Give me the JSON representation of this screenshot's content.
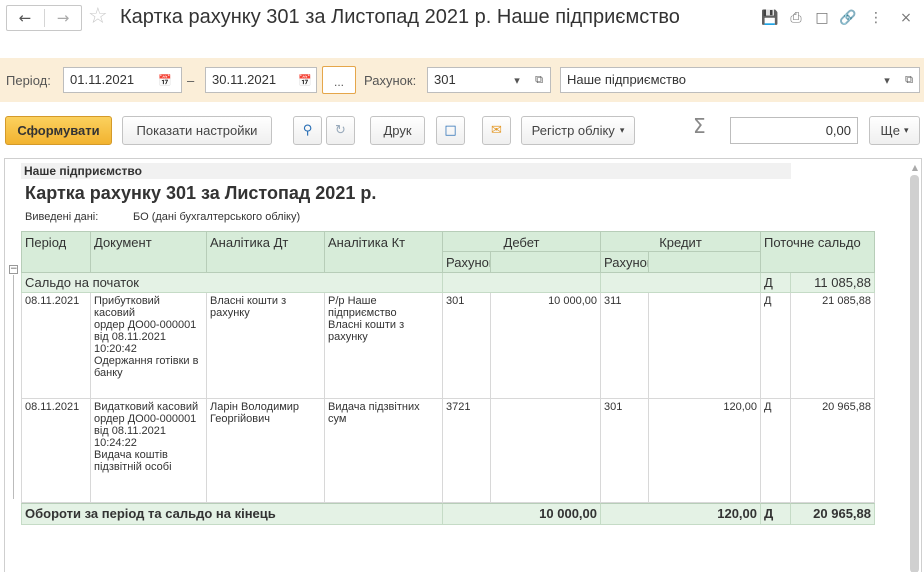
{
  "window": {
    "title": "Картка рахунку 301 за Листопад 2021 р. Наше підприємство",
    "icons": [
      "save-icon",
      "print-icon",
      "preview-icon",
      "link-icon",
      "more-icon",
      "close-icon"
    ]
  },
  "params": {
    "period_label": "Період:",
    "date_from": "01.11.2021",
    "dash": "–",
    "date_to": "30.11.2021",
    "dots": "...",
    "account_label": "Рахунок:",
    "account": "301",
    "organization": "Наше підприємство"
  },
  "toolbar": {
    "generate": "Сформувати",
    "show_settings": "Показати настройки",
    "print": "Друк",
    "register": "Регістр обліку",
    "sigma": "Σ",
    "sum": "0,00",
    "more": "Ще"
  },
  "report": {
    "organization": "Наше підприємство",
    "title": "Картка рахунку 301 за Листопад 2021 р.",
    "output_label": "Виведені дані:",
    "output_value": "БО (дані бухгалтерського обліку)",
    "headers": {
      "period": "Період",
      "document": "Документ",
      "analytics_dt": "Аналітика Дт",
      "analytics_kt": "Аналітика Кт",
      "debit": "Дебет",
      "credit": "Кредит",
      "balance": "Поточне сальдо",
      "account_dt": "Рахунок",
      "account_kt": "Рахунок"
    },
    "opening": {
      "label": "Сальдо на початок",
      "side": "Д",
      "amount": "11 085,88"
    },
    "rows": [
      {
        "period": "08.11.2021",
        "document": [
          "Прибутковий касовий",
          "ордер ДО00-000001",
          "від 08.11.2021",
          "10:20:42",
          "Одержання готівки в",
          "банку"
        ],
        "analytics_dt": [
          "Власні кошти з",
          "рахунку"
        ],
        "analytics_kt": [
          "Р/р Наше",
          "підприємство",
          "Власні кошти з",
          "рахунку"
        ],
        "dt_account": "301",
        "dt_amount": "10 000,00",
        "kt_account": "311",
        "kt_amount": "",
        "side": "Д",
        "balance": "21 085,88"
      },
      {
        "period": "08.11.2021",
        "document": [
          "Видатковий касовий",
          "ордер ДО00-000001",
          "від 08.11.2021",
          "10:24:22",
          "Видача коштів",
          "підзвітній особі"
        ],
        "analytics_dt": [
          "Ларін Володимир",
          "Георгійович"
        ],
        "analytics_kt": [
          "Видача підзвітних",
          "сум"
        ],
        "dt_account": "3721",
        "dt_amount": "",
        "kt_account": "301",
        "kt_amount": "120,00",
        "side": "Д",
        "balance": "20 965,88"
      }
    ],
    "totals": {
      "label": "Обороти за період та сальдо на кінець",
      "dt_amount": "10 000,00",
      "kt_amount": "120,00",
      "side": "Д",
      "balance": "20 965,88"
    }
  }
}
